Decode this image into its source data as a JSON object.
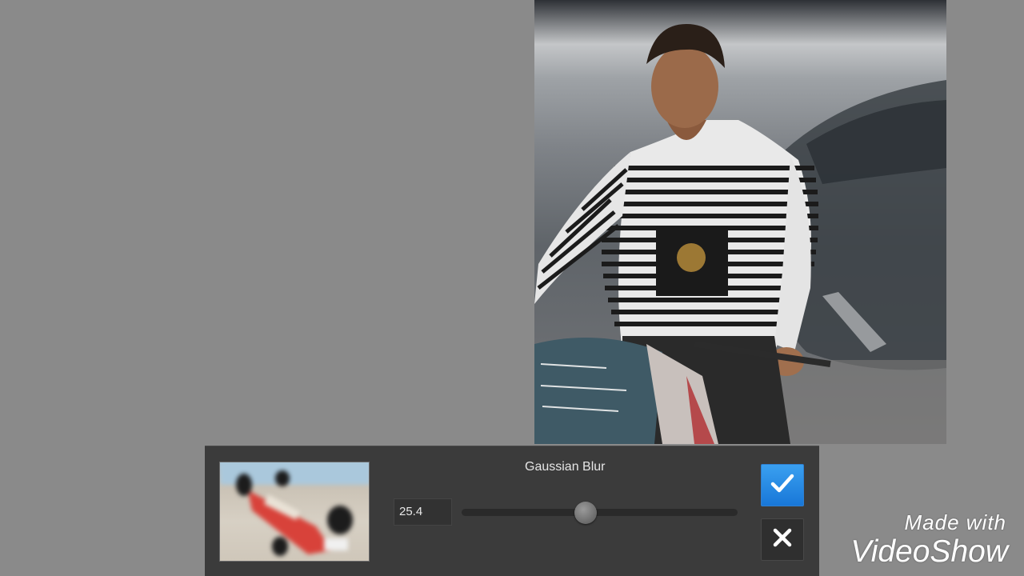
{
  "dialog": {
    "title": "Gaussian Blur",
    "blur_value": "25.4",
    "slider_fraction": 0.45,
    "confirm_icon": "checkmark-icon",
    "cancel_icon": "close-icon"
  },
  "photo": {
    "kind": "photo"
  },
  "preview": {
    "kind": "blurred-thumbnail"
  },
  "watermark": {
    "line1": "Made with",
    "line2": "VideoShow"
  },
  "colors": {
    "background": "#8a8a8a",
    "panel": "#3b3b3b",
    "accent": "#1f86e4"
  }
}
